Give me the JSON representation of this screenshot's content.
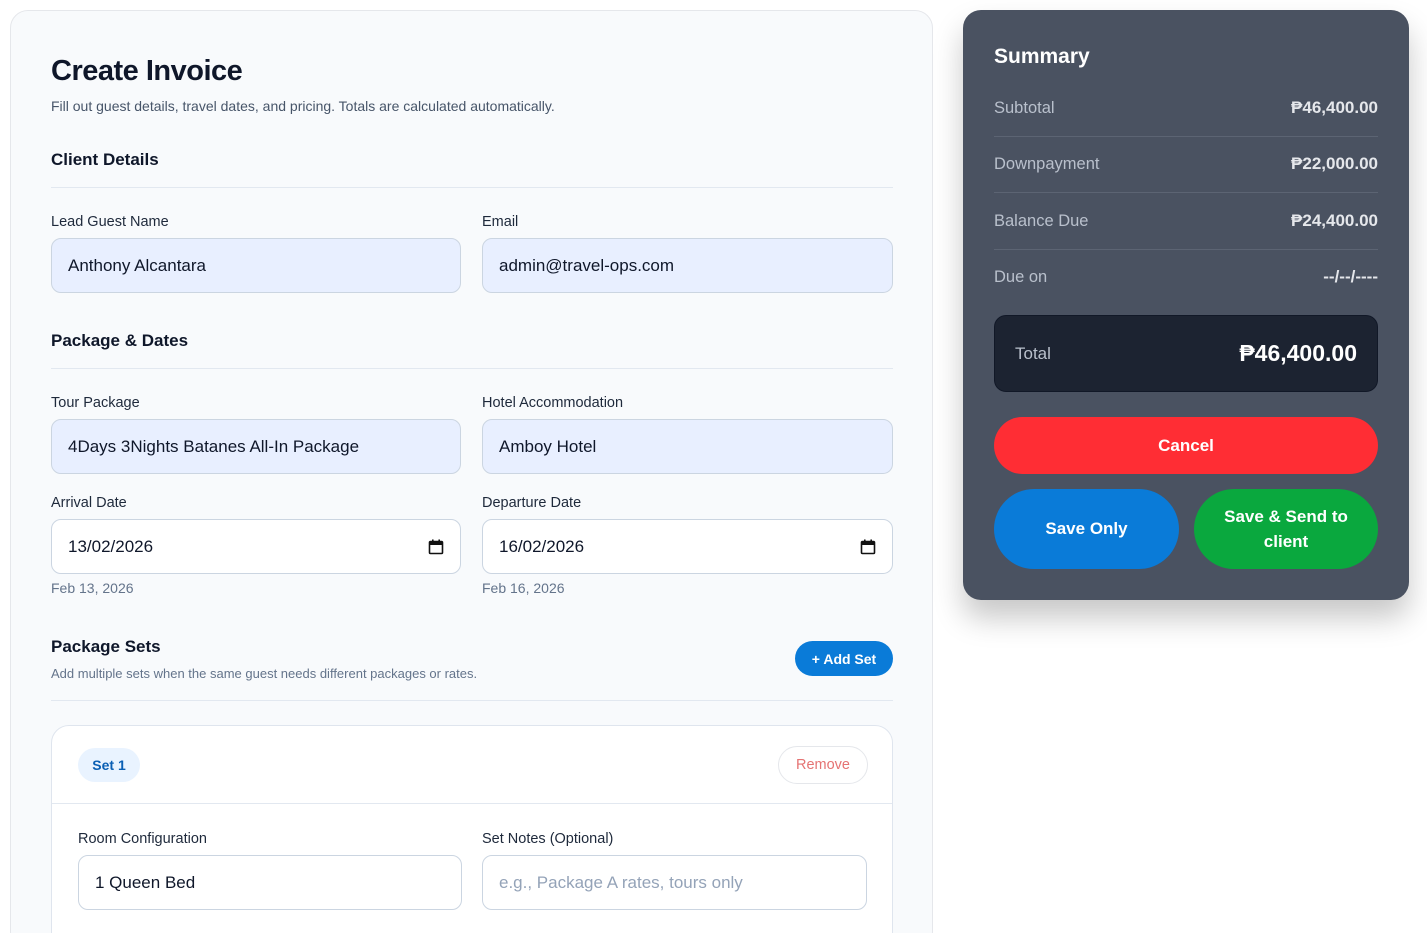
{
  "page": {
    "title": "Create Invoice",
    "subtitle": "Fill out guest details, travel dates, and pricing. Totals are calculated automatically."
  },
  "client_details": {
    "title": "Client Details",
    "lead_guest_label": "Lead Guest Name",
    "lead_guest_value": "Anthony Alcantara",
    "email_label": "Email",
    "email_value": "admin@travel-ops.com"
  },
  "package_dates": {
    "title": "Package & Dates",
    "tour_package_label": "Tour Package",
    "tour_package_value": "4Days 3Nights Batanes All-In Package",
    "hotel_label": "Hotel Accommodation",
    "hotel_value": "Amboy Hotel",
    "arrival_label": "Arrival Date",
    "arrival_value": "13/02/2026",
    "arrival_helper": "Feb 13, 2026",
    "departure_label": "Departure Date",
    "departure_value": "16/02/2026",
    "departure_helper": "Feb 16, 2026"
  },
  "package_sets": {
    "title": "Package Sets",
    "subtitle": "Add multiple sets when the same guest needs different packages or rates.",
    "add_button": "+ Add Set",
    "sets": [
      {
        "badge": "Set 1",
        "remove_label": "Remove",
        "room_config_label": "Room Configuration",
        "room_config_value": "1 Queen Bed",
        "notes_label": "Set Notes (Optional)",
        "notes_placeholder": "e.g., Package A rates, tours only"
      }
    ]
  },
  "summary": {
    "title": "Summary",
    "rows": [
      {
        "label": "Subtotal",
        "value": "₱46,400.00"
      },
      {
        "label": "Downpayment",
        "value": "₱22,000.00"
      },
      {
        "label": "Balance Due",
        "value": "₱24,400.00"
      },
      {
        "label": "Due on",
        "value": "--/--/----"
      }
    ],
    "total_label": "Total",
    "total_value": "₱46,400.00",
    "cancel_label": "Cancel",
    "save_label": "Save Only",
    "send_label": "Save & Send to client"
  },
  "colors": {
    "primary": "#0a7bd8",
    "danger": "#ff2d34",
    "success": "#0aa83e",
    "summary_bg": "#4a5261",
    "field_bg": "#e8efff"
  }
}
